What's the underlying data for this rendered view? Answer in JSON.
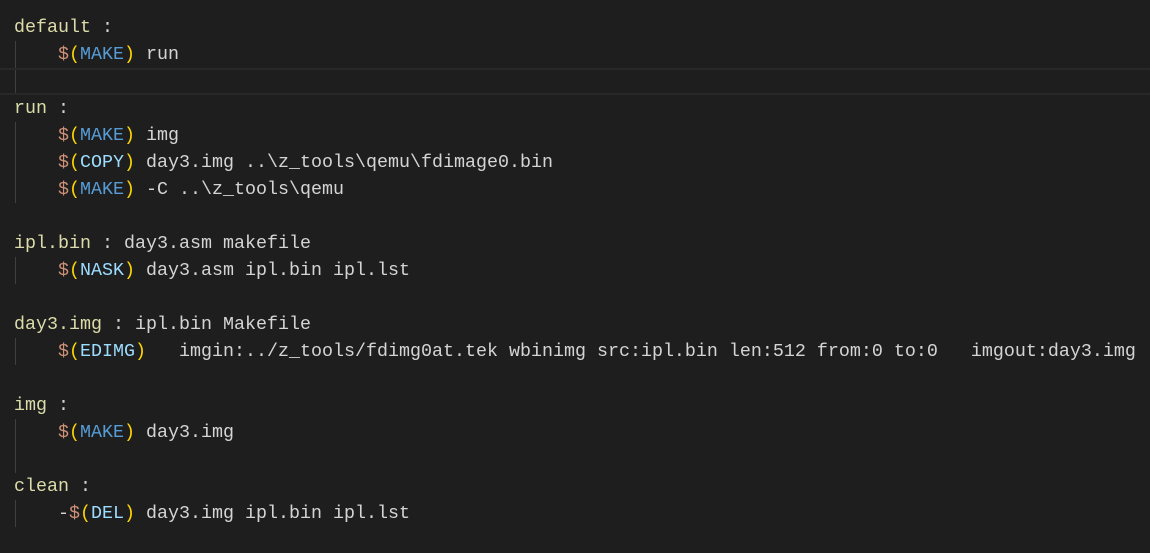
{
  "editor": {
    "current_line": 2,
    "lines": [
      {
        "indent": false,
        "tokens": [
          {
            "t": "default",
            "k": "target"
          },
          {
            "t": " :",
            "k": "plain"
          }
        ]
      },
      {
        "indent": true,
        "tokens": [
          {
            "t": "    ",
            "k": "plain"
          },
          {
            "t": "$",
            "k": "dollar"
          },
          {
            "t": "(",
            "k": "paren"
          },
          {
            "t": "MAKE",
            "k": "builtin"
          },
          {
            "t": ")",
            "k": "paren"
          },
          {
            "t": " run",
            "k": "plain"
          }
        ]
      },
      {
        "indent": true,
        "tokens": []
      },
      {
        "indent": false,
        "tokens": [
          {
            "t": "run",
            "k": "target"
          },
          {
            "t": " :",
            "k": "plain"
          }
        ]
      },
      {
        "indent": true,
        "tokens": [
          {
            "t": "    ",
            "k": "plain"
          },
          {
            "t": "$",
            "k": "dollar"
          },
          {
            "t": "(",
            "k": "paren"
          },
          {
            "t": "MAKE",
            "k": "builtin"
          },
          {
            "t": ")",
            "k": "paren"
          },
          {
            "t": " img",
            "k": "plain"
          }
        ]
      },
      {
        "indent": true,
        "tokens": [
          {
            "t": "    ",
            "k": "plain"
          },
          {
            "t": "$",
            "k": "dollar"
          },
          {
            "t": "(",
            "k": "paren"
          },
          {
            "t": "COPY",
            "k": "var"
          },
          {
            "t": ")",
            "k": "paren"
          },
          {
            "t": " day3.img ..\\z_tools\\qemu\\fdimage0.bin",
            "k": "plain"
          }
        ]
      },
      {
        "indent": true,
        "tokens": [
          {
            "t": "    ",
            "k": "plain"
          },
          {
            "t": "$",
            "k": "dollar"
          },
          {
            "t": "(",
            "k": "paren"
          },
          {
            "t": "MAKE",
            "k": "builtin"
          },
          {
            "t": ")",
            "k": "paren"
          },
          {
            "t": " -C ..\\z_tools\\qemu",
            "k": "plain"
          }
        ]
      },
      {
        "indent": false,
        "tokens": []
      },
      {
        "indent": false,
        "tokens": [
          {
            "t": "ipl.bin",
            "k": "target"
          },
          {
            "t": " : day3.asm makefile",
            "k": "plain"
          }
        ]
      },
      {
        "indent": true,
        "tokens": [
          {
            "t": "    ",
            "k": "plain"
          },
          {
            "t": "$",
            "k": "dollar"
          },
          {
            "t": "(",
            "k": "paren"
          },
          {
            "t": "NASK",
            "k": "var"
          },
          {
            "t": ")",
            "k": "paren"
          },
          {
            "t": " day3.asm ipl.bin ipl.lst",
            "k": "plain"
          }
        ]
      },
      {
        "indent": false,
        "tokens": []
      },
      {
        "indent": false,
        "tokens": [
          {
            "t": "day3.img",
            "k": "target"
          },
          {
            "t": " : ipl.bin Makefile",
            "k": "plain"
          }
        ]
      },
      {
        "indent": true,
        "tokens": [
          {
            "t": "    ",
            "k": "plain"
          },
          {
            "t": "$",
            "k": "dollar"
          },
          {
            "t": "(",
            "k": "paren"
          },
          {
            "t": "EDIMG",
            "k": "var"
          },
          {
            "t": ")",
            "k": "paren"
          },
          {
            "t": "   imgin:../z_tools/fdimg0at.tek wbinimg src:ipl.bin len:512 from:0 to:0   imgout:day3.img",
            "k": "plain"
          }
        ]
      },
      {
        "indent": false,
        "tokens": []
      },
      {
        "indent": false,
        "tokens": [
          {
            "t": "img",
            "k": "target"
          },
          {
            "t": " :",
            "k": "plain"
          }
        ]
      },
      {
        "indent": true,
        "tokens": [
          {
            "t": "    ",
            "k": "plain"
          },
          {
            "t": "$",
            "k": "dollar"
          },
          {
            "t": "(",
            "k": "paren"
          },
          {
            "t": "MAKE",
            "k": "builtin"
          },
          {
            "t": ")",
            "k": "paren"
          },
          {
            "t": " day3.img",
            "k": "plain"
          }
        ]
      },
      {
        "indent": true,
        "tokens": []
      },
      {
        "indent": false,
        "tokens": [
          {
            "t": "clean",
            "k": "target"
          },
          {
            "t": " :",
            "k": "plain"
          }
        ]
      },
      {
        "indent": true,
        "tokens": [
          {
            "t": "    -",
            "k": "plain"
          },
          {
            "t": "$",
            "k": "dollar"
          },
          {
            "t": "(",
            "k": "paren"
          },
          {
            "t": "DEL",
            "k": "var"
          },
          {
            "t": ")",
            "k": "paren"
          },
          {
            "t": " day3.img ipl.bin ipl.lst",
            "k": "plain"
          }
        ]
      }
    ]
  }
}
